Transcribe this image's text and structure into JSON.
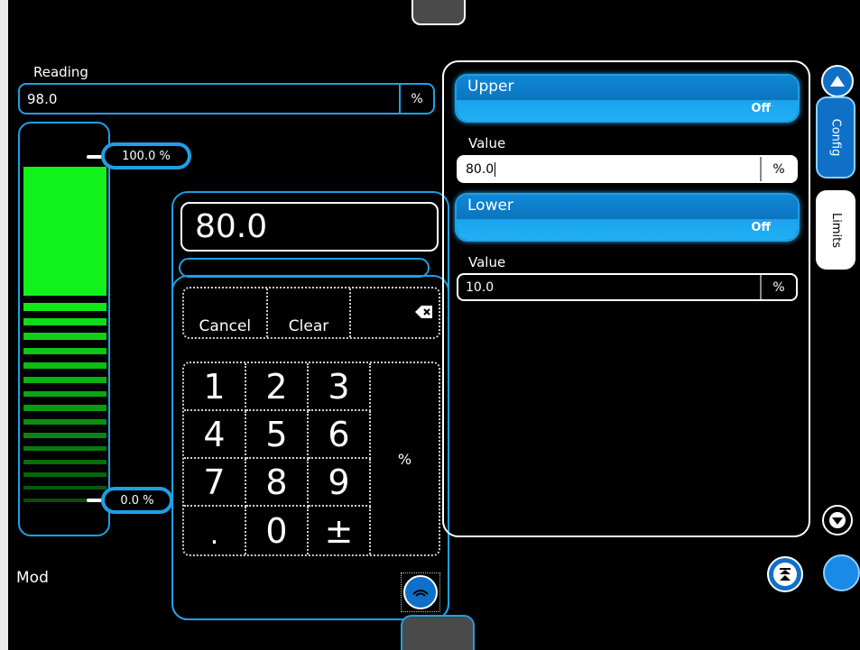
{
  "reading": {
    "label": "Reading",
    "value": "98.0",
    "unit": "%"
  },
  "bar": {
    "level_fraction": 0.98,
    "top_marker": "100.0 %",
    "bottom_marker": "0.0 %",
    "fill_color": "#11f21b"
  },
  "mode_label": "Mod",
  "keypad": {
    "display_value": "80.0",
    "cancel_label": "Cancel",
    "clear_label": "Clear",
    "backspace_icon": "backspace-icon",
    "keys": [
      [
        "1",
        "2",
        "3"
      ],
      [
        "4",
        "5",
        "6"
      ],
      [
        "7",
        "8",
        "9"
      ],
      [
        ".",
        "0",
        "±"
      ]
    ],
    "unit_key": "%",
    "close_icon": "keyboard-hide-icon"
  },
  "limits": {
    "upper": {
      "title": "Upper",
      "state": "Off",
      "value_label": "Value",
      "value": "80.0",
      "unit": "%"
    },
    "lower": {
      "title": "Lower",
      "state": "Off",
      "value_label": "Value",
      "value": "10.0",
      "unit": "%"
    }
  },
  "side_tabs": {
    "config": "Config",
    "limits": "Limits"
  },
  "colors": {
    "accent": "#1ea0e6",
    "button_blue": "#1070c8",
    "bar_green": "#11f21b"
  }
}
